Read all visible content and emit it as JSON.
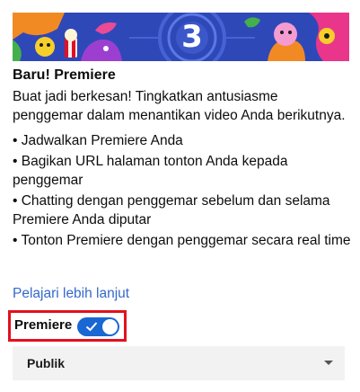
{
  "banner": {
    "countdown": "3",
    "accent_color": "#2f48b8"
  },
  "title": "Baru! Premiere",
  "description": "Buat jadi berkesan! Tingkatkan antusiasme penggemar dalam menantikan video Anda berikutnya.",
  "bullets": [
    "• Jadwalkan Premiere Anda",
    "• Bagikan URL halaman tonton Anda kepada penggemar",
    "• Chatting dengan penggemar sebelum dan selama Premiere Anda diputar",
    "• Tonton Premiere dengan penggemar secara real time"
  ],
  "learn_more": "Pelajari lebih lanjut",
  "premiere_toggle": {
    "label": "Premiere",
    "checked": true,
    "on_color": "#1967d2"
  },
  "visibility_select": {
    "value": "Publik",
    "icon": "chevron-down-icon"
  },
  "highlight_color": "#e3101e"
}
